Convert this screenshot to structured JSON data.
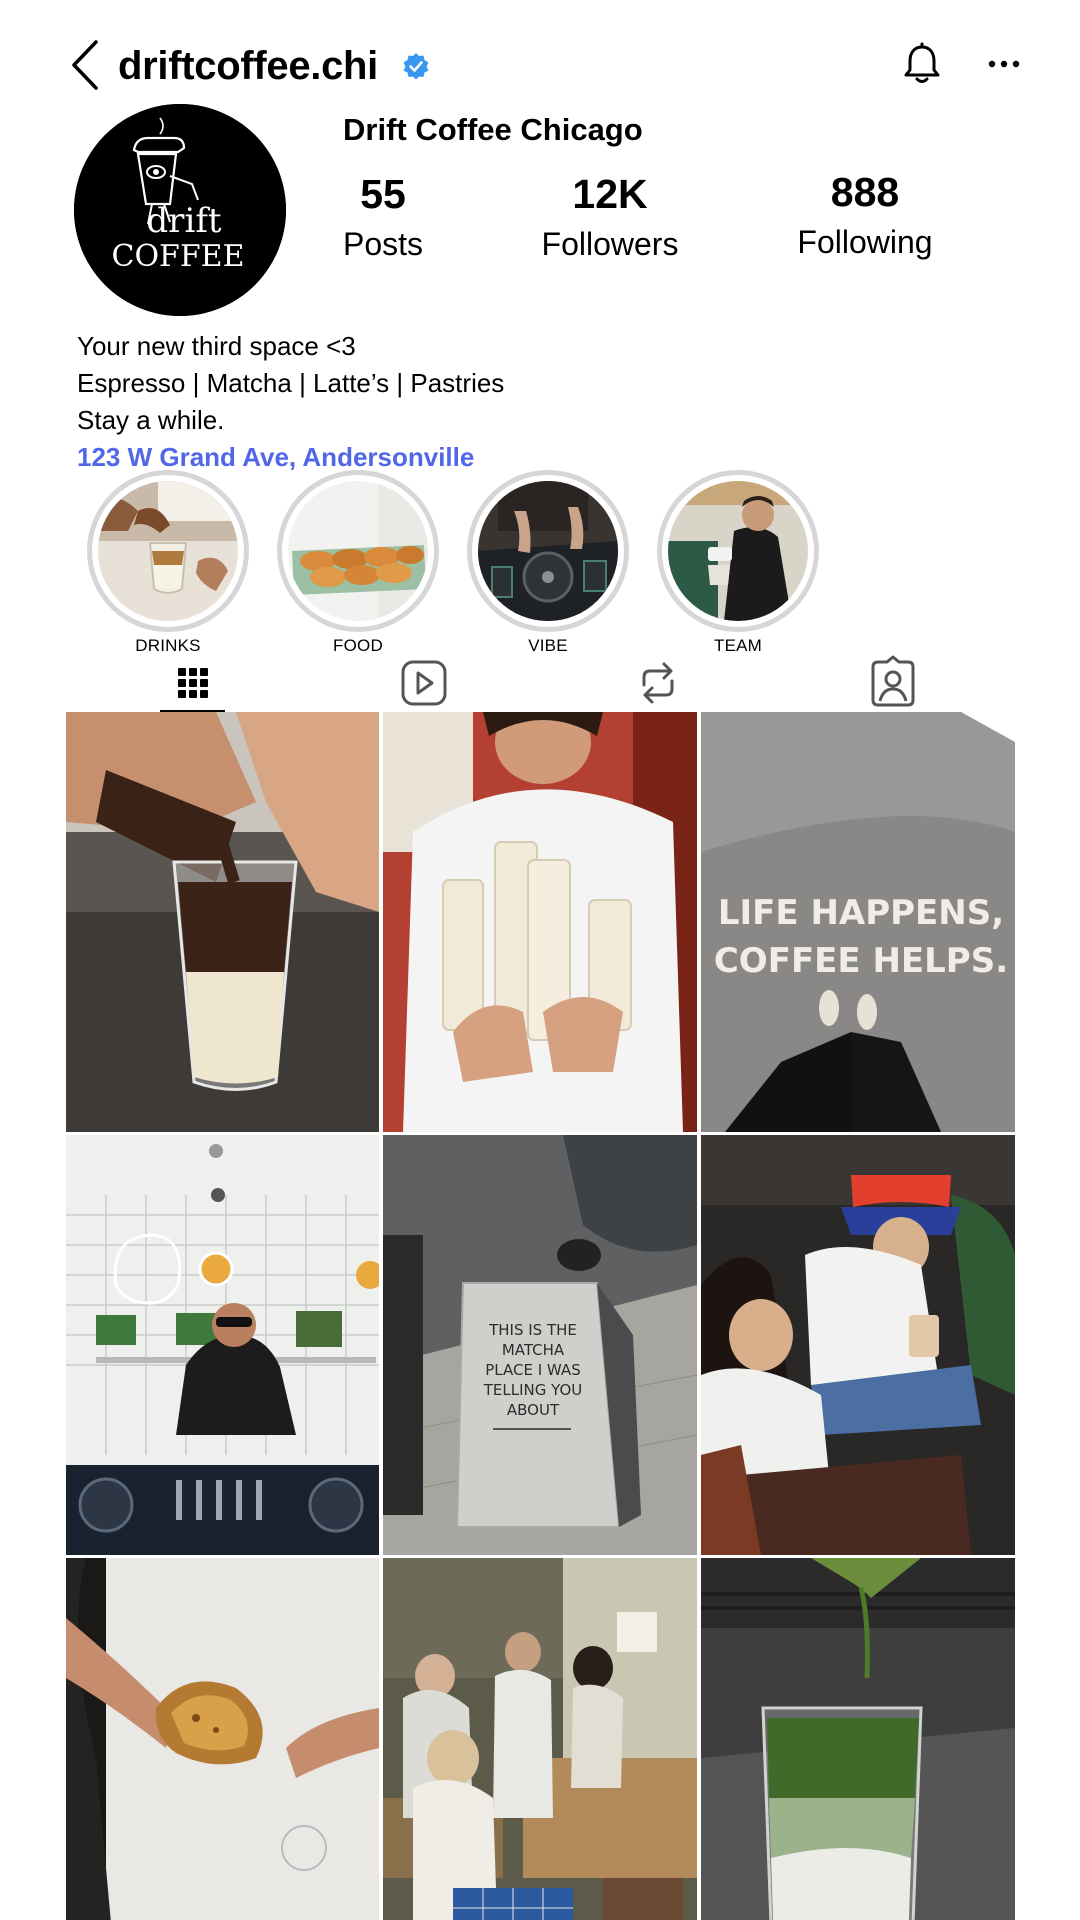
{
  "header": {
    "username": "driftcoffee.chi",
    "verified": true,
    "back_icon": "chevron-left-icon",
    "notification_icon": "bell-icon",
    "more_icon": "more-horizontal-icon",
    "verified_color": "#3897f0"
  },
  "avatar": {
    "brand_line1": "drift",
    "brand_line2": "COFFEE"
  },
  "profile": {
    "display_name": "Drift Coffee Chicago",
    "stats": {
      "posts": {
        "value": "55",
        "label": "Posts"
      },
      "followers": {
        "value": "12K",
        "label": "Followers"
      },
      "following": {
        "value": "888",
        "label": "Following"
      }
    },
    "bio": [
      "Your new third space <3",
      "Espresso | Matcha | Latte’s | Pastries",
      "Stay a while."
    ],
    "location_link": "123 W Grand Ave, Andersonville",
    "link_color": "#5266e8"
  },
  "highlights": [
    {
      "label": "DRINKS"
    },
    {
      "label": "FOOD"
    },
    {
      "label": "VIBE"
    },
    {
      "label": "TEAM"
    }
  ],
  "tabs": [
    {
      "name": "posts-grid",
      "icon": "grid-icon",
      "selected": true
    },
    {
      "name": "reels",
      "icon": "reels-icon",
      "selected": false
    },
    {
      "name": "reposts",
      "icon": "repost-icon",
      "selected": false
    },
    {
      "name": "tagged",
      "icon": "tagged-user-icon",
      "selected": false
    }
  ],
  "posts": {
    "post3_sign_line1": "LIFE HAPPENS,",
    "post3_sign_line2": "COFFEE HELPS.",
    "post5_sign": [
      "THIS IS THE",
      "MATCHA",
      "PLACE I WAS",
      "TELLING YOU",
      "ABOUT"
    ]
  }
}
